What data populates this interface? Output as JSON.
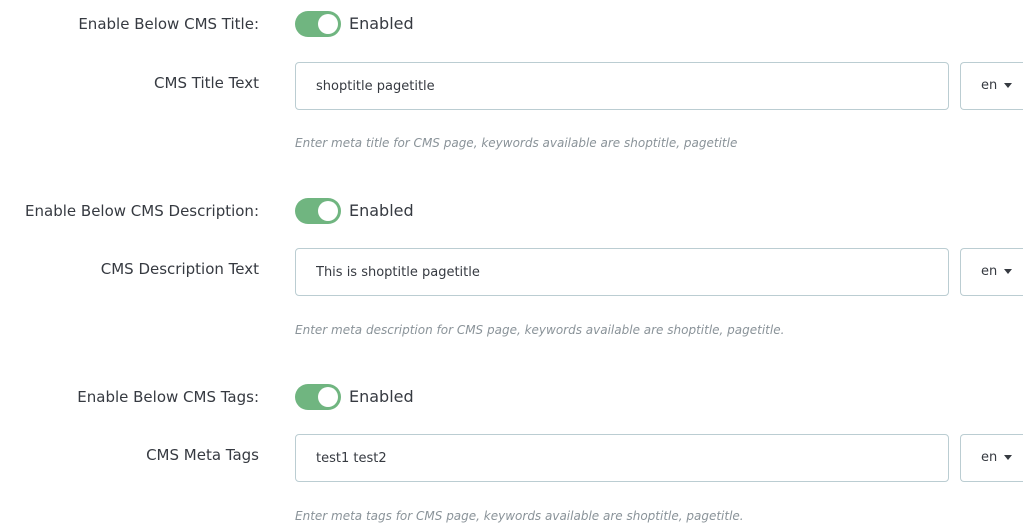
{
  "sections": [
    {
      "toggle_label": "Enable Below CMS Title:",
      "toggle_state": "Enabled",
      "input_label": "CMS Title Text",
      "input_value": "shoptitle pagetitle",
      "lang": "en",
      "help": "Enter meta title for CMS page, keywords available are shoptitle, pagetitle"
    },
    {
      "toggle_label": "Enable Below CMS Description:",
      "toggle_state": "Enabled",
      "input_label": "CMS Description Text",
      "input_value": "This is shoptitle pagetitle",
      "lang": "en",
      "help": "Enter meta description for CMS page, keywords available are shoptitle, pagetitle."
    },
    {
      "toggle_label": "Enable Below CMS Tags:",
      "toggle_state": "Enabled",
      "input_label": "CMS Meta Tags",
      "input_value": "test1 test2",
      "lang": "en",
      "help": "Enter meta tags for CMS page, keywords available are shoptitle, pagetitle."
    }
  ],
  "colors": {
    "toggle_on": "#70b580",
    "input_border": "#bbcdd2",
    "help_text": "#8a9399",
    "label_text": "#363a41"
  }
}
